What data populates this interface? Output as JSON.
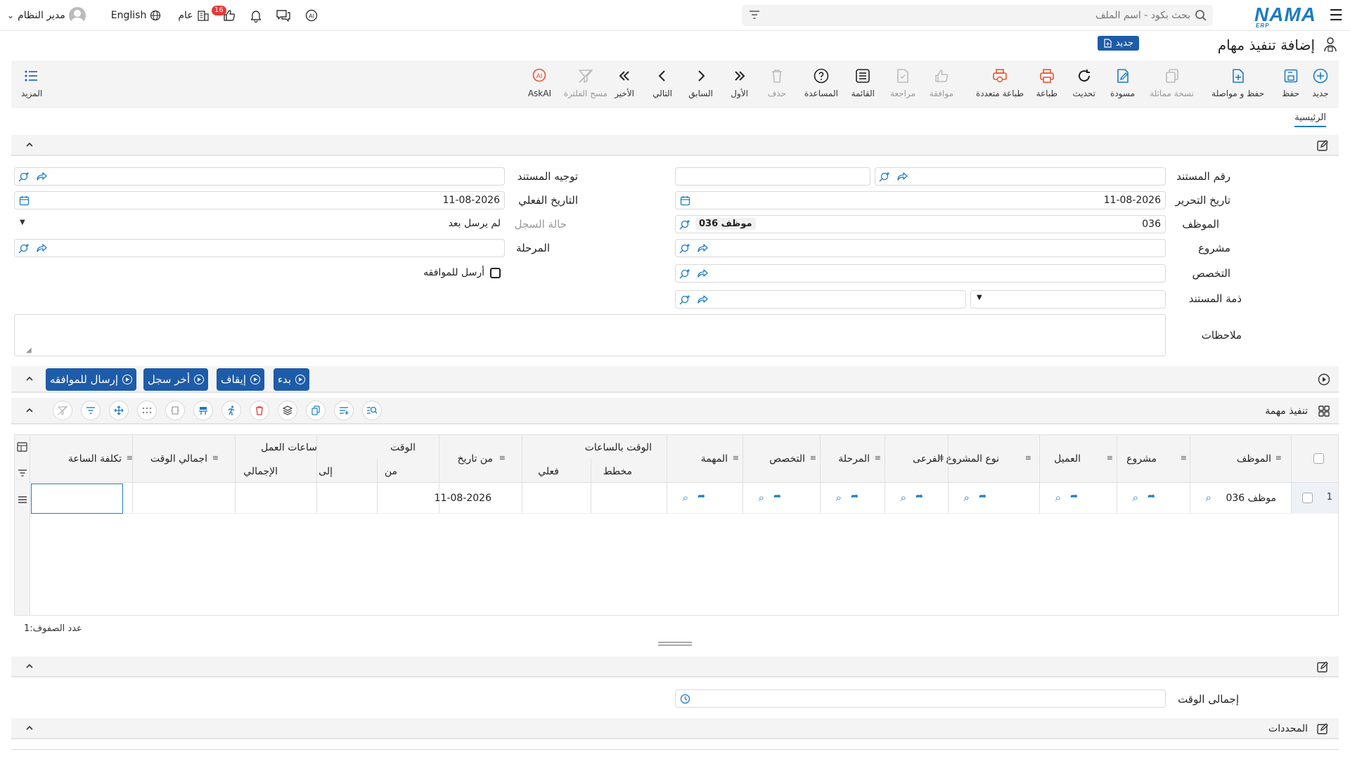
{
  "topbar": {
    "logo": "NAMA",
    "logo_sub": "ERP",
    "search_placeholder": "بحث بكود - اسم الملف",
    "user_name": "مدير النظام",
    "language": "English",
    "scope": "عام",
    "notif_count": "16"
  },
  "page": {
    "title": "إضافة تنفيذ مهام",
    "badge": "جديد"
  },
  "toolbar": {
    "new": "جديد",
    "save": "حفظ",
    "save_continue": "حفظ و مواصلة",
    "copy": "نسخة مماثلة",
    "draft": "مسودة",
    "refresh": "تحديث",
    "print": "طباعة",
    "multi_print": "طباعة متعددة",
    "approve": "موافقة",
    "review": "مراجعة",
    "list": "القائمة",
    "help": "المساعدة",
    "delete": "حذف",
    "first": "الأول",
    "previous": "السابق",
    "next": "التالي",
    "last": "الأخير",
    "clear_filter": "مسح الفلترة",
    "askai": "AskAI",
    "more": "المزيد"
  },
  "tabs": {
    "main": "الرئيسية"
  },
  "form": {
    "doc_no_label": "رقم المستند",
    "doc_direction_label": "توجيه المستند",
    "write_date_label": "تاريخ التحرير",
    "write_date": "11-08-2026",
    "actual_date_label": "التاريخ الفعلي",
    "actual_date": "11-08-2026",
    "employee_label": "الموظف",
    "employee_code": "036",
    "employee_name": "موظف 036",
    "record_status_label": "حالة السجل",
    "record_status": "لم يرسل بعد",
    "project_label": "مشروع",
    "stage_label": "المرحلة",
    "specialty_label": "التخصص",
    "send_approval_label": "أرسل للموافقه",
    "doc_liability_label": "ذمة المستند",
    "notes_label": "ملاحظات"
  },
  "actions": {
    "start": "بدء",
    "stop": "إيقاف",
    "last_record": "أخر سجل",
    "send_approval": "إرسال للموافقه"
  },
  "grid": {
    "title": "تنفيذ مهمة",
    "columns": {
      "employee": "الموظف",
      "project": "مشروع",
      "customer": "العميل",
      "subproject_type": "نوع المشروع الفرعى",
      "stage": "المرحلة",
      "specialty": "التخصص",
      "task": "المهمة",
      "hours_group": "الوقت بالساعات",
      "planned": "مخطط",
      "actual": "فعلي",
      "from_date": "من تاريخ",
      "time_group": "الوقت",
      "from": "من",
      "to": "إلى",
      "work_hours_group": "ساعات العمل",
      "total": "الإجمالي",
      "total_time": "اجمالي الوقت",
      "hour_cost": "تكلفة الساعة"
    },
    "rows": [
      {
        "num": "1",
        "employee": "موظف 036",
        "from_date": "11-08-2026"
      }
    ],
    "row_count_label": "عدد الصفوف:",
    "row_count": "1"
  },
  "totals_section": {
    "total_time_label": "إجمالى الوقت"
  },
  "determinants_section": {
    "title": "المحددات"
  }
}
